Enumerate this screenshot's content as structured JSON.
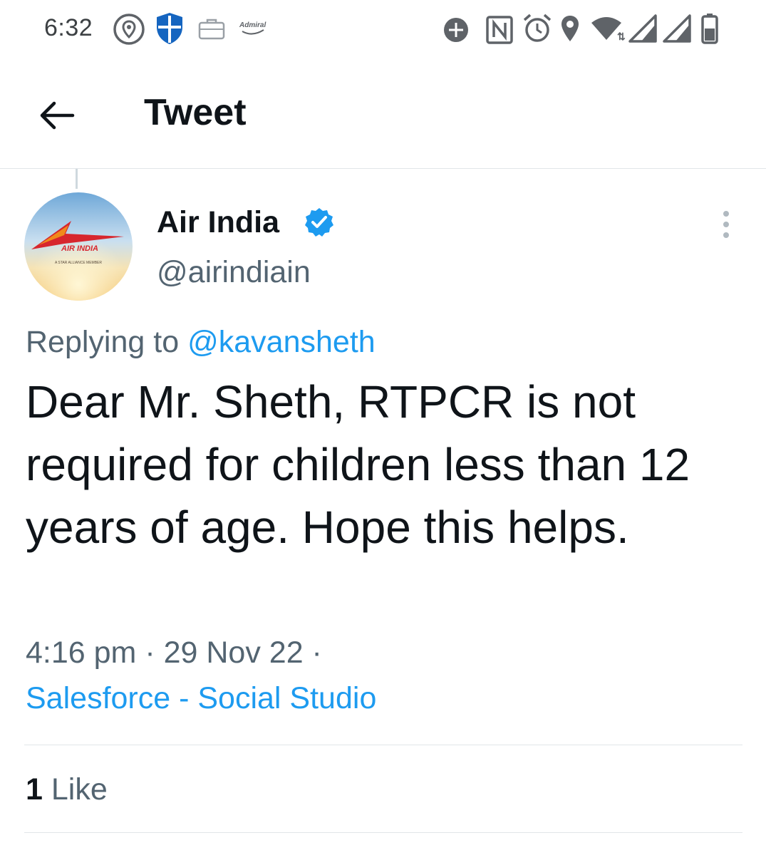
{
  "status_bar": {
    "time": "6:32",
    "admiral_label": "Admiral",
    "icons": [
      "location-pin-icon",
      "shield-icon",
      "briefcase-icon",
      "admiral-app-icon",
      "data-saver-icon",
      "nfc-icon",
      "alarm-icon",
      "location-icon",
      "wifi-icon",
      "signal-icon",
      "signal-icon-2",
      "battery-icon"
    ]
  },
  "header": {
    "back_icon": "arrow-left-icon",
    "title": "Tweet"
  },
  "tweet": {
    "author": {
      "name": "Air India",
      "verified": true,
      "handle": "@airindiain",
      "avatar_text": "AIR INDIA",
      "avatar_subtext": "A STAR ALLIANCE MEMBER"
    },
    "reply_to": {
      "label": "Replying to",
      "mention": "@kavansheth"
    },
    "text": "Dear Mr. Sheth, RTPCR is not required for children less than 12 years of age. Hope this helps.",
    "meta": "4:16 pm · 29 Nov 22 ·",
    "source": "Salesforce - Social Studio",
    "likes": {
      "count": "1",
      "label": "Like"
    }
  },
  "colors": {
    "accent": "#1d9bf0",
    "text_primary": "#0f1419",
    "text_secondary": "#536471",
    "divider": "#e1e5e8",
    "brand_red": "#d7262e"
  }
}
